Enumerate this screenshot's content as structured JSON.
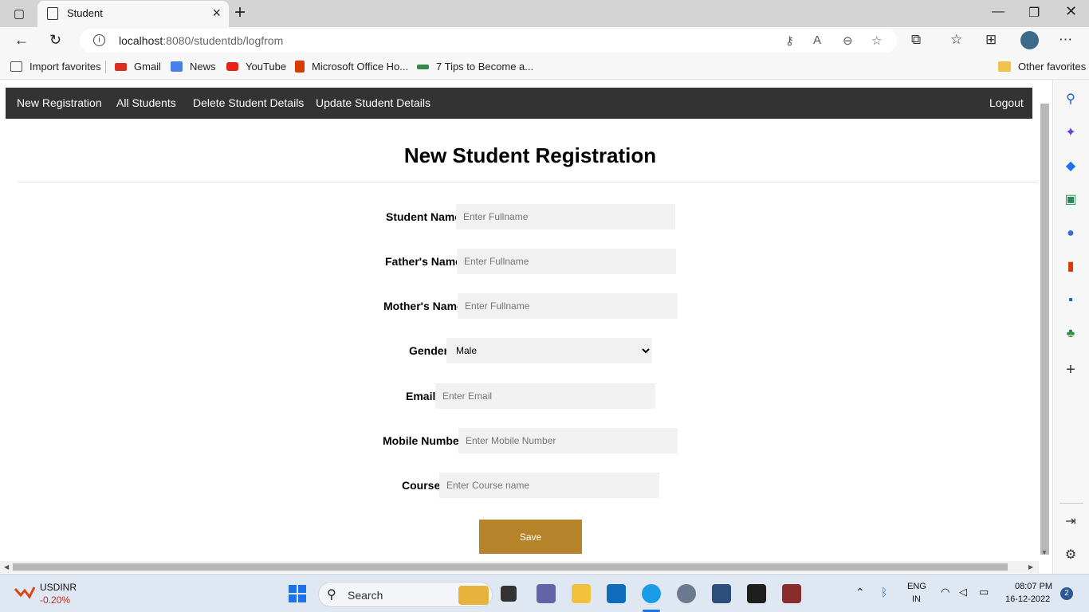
{
  "browser": {
    "tab_title": "Student",
    "url_host": "localhost",
    "url_rest": ":8080/studentdb/logfrom",
    "favorites": [
      {
        "label": "Import favorites",
        "color": "#555555"
      },
      {
        "label": "Gmail",
        "color": "#d93025"
      },
      {
        "label": "News",
        "color": "#4a7ee8"
      },
      {
        "label": "YouTube",
        "color": "#e62117"
      },
      {
        "label": "Microsoft Office Ho...",
        "color": "#d83b01"
      },
      {
        "label": "7 Tips to Become a...",
        "color": "#2f8d46"
      }
    ],
    "other_favorites": "Other favorites"
  },
  "nav": {
    "items": [
      "New Registration",
      "All Students",
      "Delete Student Details",
      "Update Student Details"
    ],
    "logout": "Logout"
  },
  "form": {
    "title": "New Student Registration",
    "fields": {
      "student_name": {
        "label": "Student Name",
        "placeholder": "Enter Fullname"
      },
      "father_name": {
        "label": "Father's Name",
        "placeholder": "Enter Fullname"
      },
      "mother_name": {
        "label": "Mother's Name",
        "placeholder": "Enter Fullname"
      },
      "gender": {
        "label": "Gender",
        "value": "Male"
      },
      "email": {
        "label": "Email",
        "placeholder": "Enter Email"
      },
      "mobile": {
        "label": "Mobile Number",
        "placeholder": "Enter Mobile Number"
      },
      "course": {
        "label": "Course",
        "placeholder": "Enter Course name"
      }
    },
    "save_label": "Save"
  },
  "taskbar": {
    "ticker_name": "USDINR",
    "ticker_change": "-0.20%",
    "search_label": "Search",
    "lang_line1": "ENG",
    "lang_line2": "IN",
    "time": "08:07 PM",
    "date": "16-12-2022",
    "notification_count": "2"
  },
  "colors": {
    "navbar": "#333333",
    "save_button": "#b5832a",
    "ticker_negative": "#c42b1c"
  }
}
